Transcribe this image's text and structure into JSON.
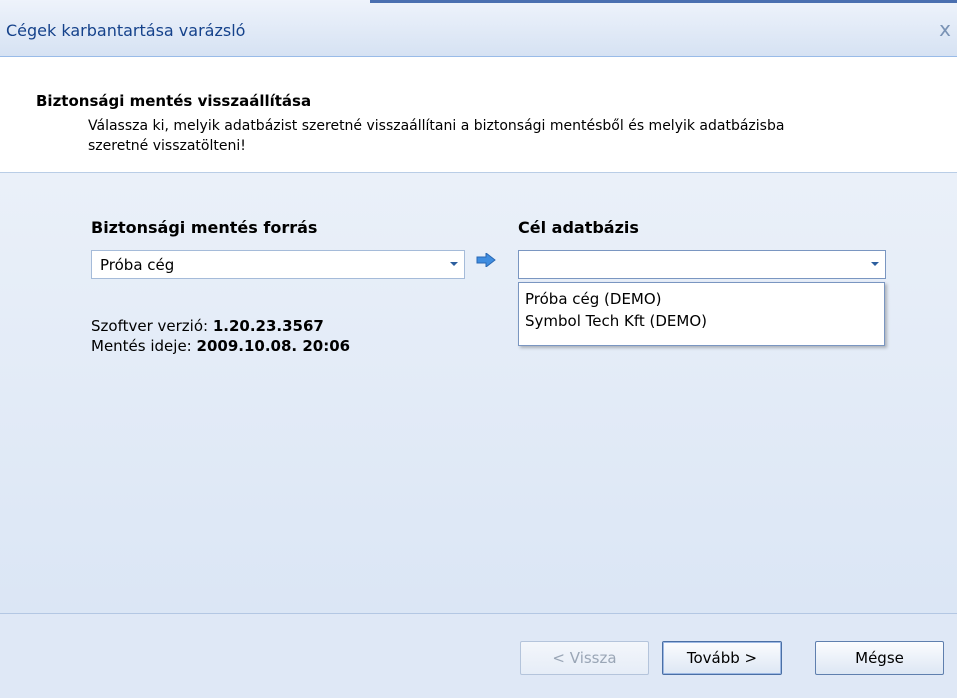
{
  "window": {
    "title": "Cégek karbantartása varázsló",
    "close_glyph": "x"
  },
  "header": {
    "title": "Biztonsági mentés visszaállítása",
    "description": "Válassza ki, melyik adatbázist szeretné visszaállítani a biztonsági mentésből és melyik adatbázisba szeretné visszatölteni!"
  },
  "source": {
    "label": "Biztonsági mentés forrás",
    "selected": "Próba cég",
    "software_version_label": "Szoftver verzió: ",
    "software_version_value": "1.20.23.3567",
    "backup_time_label": "Mentés ideje: ",
    "backup_time_value": "2009.10.08. 20:06"
  },
  "target": {
    "label": "Cél adatbázis",
    "selected": "",
    "options": [
      "Próba cég (DEMO)",
      "Symbol Tech Kft (DEMO)"
    ]
  },
  "icons": {
    "arrow": "arrow-right-icon",
    "dropdown": "chevron-down-icon",
    "close": "close-icon"
  },
  "buttons": {
    "back": "< Vissza",
    "next": "Tovább >",
    "cancel": "Mégse"
  }
}
